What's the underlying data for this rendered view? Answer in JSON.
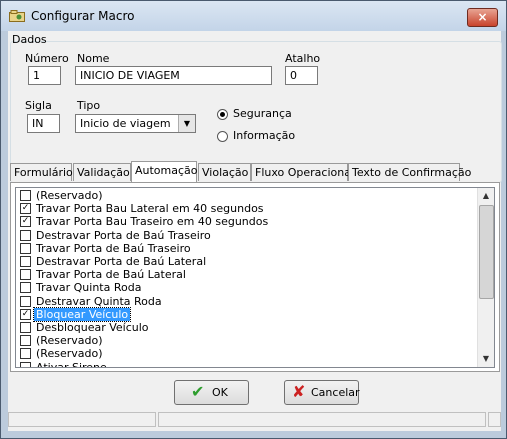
{
  "window": {
    "title": "Configurar Macro",
    "close": "×"
  },
  "dados": {
    "group_label": "Dados",
    "numero": {
      "label": "Número",
      "value": "1"
    },
    "nome": {
      "label": "Nome",
      "value": "INICIO DE VIAGEM"
    },
    "atalho": {
      "label": "Atalho",
      "value": "0"
    },
    "sigla": {
      "label": "Sigla",
      "value": "IN"
    },
    "tipo": {
      "label": "Tipo",
      "value": "Inicio de viagem"
    },
    "radio_seguranca": {
      "label": "Segurança",
      "checked": true
    },
    "radio_informacao": {
      "label": "Informação",
      "checked": false
    }
  },
  "tabs": [
    "Formulário",
    "Validação",
    "Automação",
    "Violação",
    "Fluxo Operacional",
    "Texto de Confirmação"
  ],
  "active_tab": "Automação",
  "automation_items": [
    {
      "label": "(Reservado)",
      "checked": false
    },
    {
      "label": "Travar Porta Bau Lateral em 40 segundos",
      "checked": true
    },
    {
      "label": "Travar Porta Bau Traseiro em 40 segundos",
      "checked": true
    },
    {
      "label": "Destravar Porta de Baú Traseiro",
      "checked": false
    },
    {
      "label": "Travar Porta de Baú Traseiro",
      "checked": false
    },
    {
      "label": "Destravar Porta de Baú Lateral",
      "checked": false
    },
    {
      "label": "Travar Porta de Baú Lateral",
      "checked": false
    },
    {
      "label": "Travar Quinta Roda",
      "checked": false
    },
    {
      "label": "Destravar Quinta Roda",
      "checked": false
    },
    {
      "label": "Bloquear Veículo",
      "checked": true,
      "selected": true
    },
    {
      "label": "Desbloquear Veículo",
      "checked": false
    },
    {
      "label": "(Reservado)",
      "checked": false
    },
    {
      "label": "(Reservado)",
      "checked": false
    },
    {
      "label": "Ativar Sirene",
      "checked": false
    }
  ],
  "buttons": {
    "ok": "OK",
    "cancel": "Cancelar"
  },
  "colors": {
    "selection": "#3399ff",
    "ok_icon": "#2e9e2e",
    "cancel_icon": "#cc2222"
  }
}
